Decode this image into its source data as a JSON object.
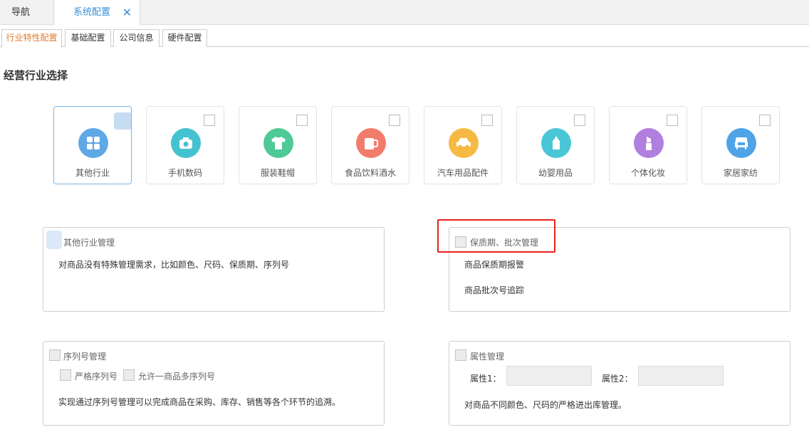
{
  "top_tabs": {
    "nav": "导航",
    "system_config": "系统配置",
    "close": "✕"
  },
  "sub_tabs": [
    "行业特性配置",
    "基础配置",
    "公司信息",
    "硬件配置"
  ],
  "section_title": "经营行业选择",
  "industries": [
    {
      "label": "其他行业",
      "color": "#5fa8e6",
      "icon": "grid-icon",
      "selected": true
    },
    {
      "label": "手机数码",
      "color": "#45c2cf",
      "icon": "camera-icon",
      "selected": false
    },
    {
      "label": "服装鞋帽",
      "color": "#4fc996",
      "icon": "shirt-icon",
      "selected": false
    },
    {
      "label": "食品饮料酒水",
      "color": "#f27c6c",
      "icon": "mug-icon",
      "selected": false
    },
    {
      "label": "汽车用品配件",
      "color": "#f5b944",
      "icon": "car-icon",
      "selected": false
    },
    {
      "label": "幼婴用品",
      "color": "#49c6d8",
      "icon": "bottle-icon",
      "selected": false
    },
    {
      "label": "个体化妆",
      "color": "#b07fe0",
      "icon": "lipstick-icon",
      "selected": false
    },
    {
      "label": "家居家纺",
      "color": "#4fa4e8",
      "icon": "sofa-icon",
      "selected": false
    }
  ],
  "panels": {
    "other": {
      "title": "其他行业管理",
      "desc": "对商品没有特殊管理需求，比如颜色、尺码、保质期、序列号"
    },
    "shelf": {
      "title": "保质期、批次管理",
      "line1": "商品保质期报警",
      "line2": "商品批次号追踪"
    },
    "serial": {
      "title": "序列号管理",
      "opt1": "严格序列号",
      "opt2": "允许一商品多序列号",
      "desc": "实现通过序列号管理可以完成商品在采购、库存、销售等各个环节的追溯。"
    },
    "attr": {
      "title": "属性管理",
      "attr1": "属性1：",
      "attr2": "属性2：",
      "desc": "对商品不同颜色、尺码的严格进出库管理。"
    }
  },
  "colors": {
    "accent_blue": "#3a8fd8",
    "active_subtab": "#e07c2e",
    "highlight_red": "#e8231a"
  }
}
